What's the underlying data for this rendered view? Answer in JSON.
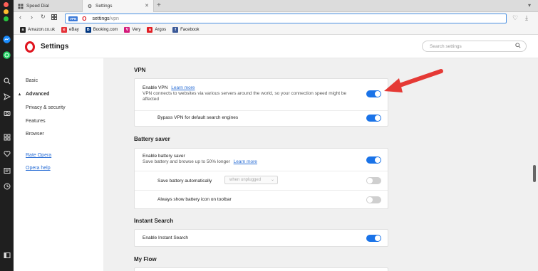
{
  "tabs": [
    {
      "label": "Speed Dial",
      "icon": "grid-icon"
    },
    {
      "label": "Settings",
      "icon": "gear-icon"
    }
  ],
  "address": {
    "vpn_badge": "VPN",
    "url_host": "settings",
    "url_path": "/vpn"
  },
  "bookmarks": [
    {
      "label": "Amazon.co.uk",
      "icon_text": "a",
      "color": "#222222"
    },
    {
      "label": "eBay",
      "icon_text": "e",
      "color": "#e53238"
    },
    {
      "label": "Booking.com",
      "icon_text": "B",
      "color": "#003580"
    },
    {
      "label": "Very",
      "icon_text": "V",
      "color": "#d4197a"
    },
    {
      "label": "Argos",
      "icon_text": "a",
      "color": "#e11f25"
    },
    {
      "label": "Facebook",
      "icon_text": "f",
      "color": "#3b5998"
    }
  ],
  "header": {
    "title": "Settings",
    "search_placeholder": "Search settings"
  },
  "nav": {
    "basic": "Basic",
    "advanced": "Advanced",
    "privacy": "Privacy & security",
    "features": "Features",
    "browser": "Browser",
    "rate": "Rate Opera",
    "help": "Opera help"
  },
  "vpn": {
    "section_title": "VPN",
    "enable_label": "Enable VPN",
    "learn_more": "Learn more",
    "description": "VPN connects to websites via various servers around the world, so your connection speed might be affected",
    "enabled": true,
    "bypass_label": "Bypass VPN for default search engines",
    "bypass_enabled": true
  },
  "battery": {
    "section_title": "Battery saver",
    "enable_label": "Enable battery saver",
    "description": "Save battery and browse up to 50% longer",
    "learn_more": "Learn more",
    "enabled": true,
    "auto_label": "Save battery automatically",
    "auto_select": "when unplugged",
    "auto_enabled": false,
    "icon_label": "Always show battery icon on toolbar",
    "icon_enabled": false
  },
  "instant": {
    "section_title": "Instant Search",
    "enable_label": "Enable Instant Search",
    "enabled": true
  },
  "myflow": {
    "section_title": "My Flow"
  },
  "colors": {
    "accent": "#1a73e8",
    "opera_red": "#e0141e",
    "annotation_red": "#e53935"
  }
}
